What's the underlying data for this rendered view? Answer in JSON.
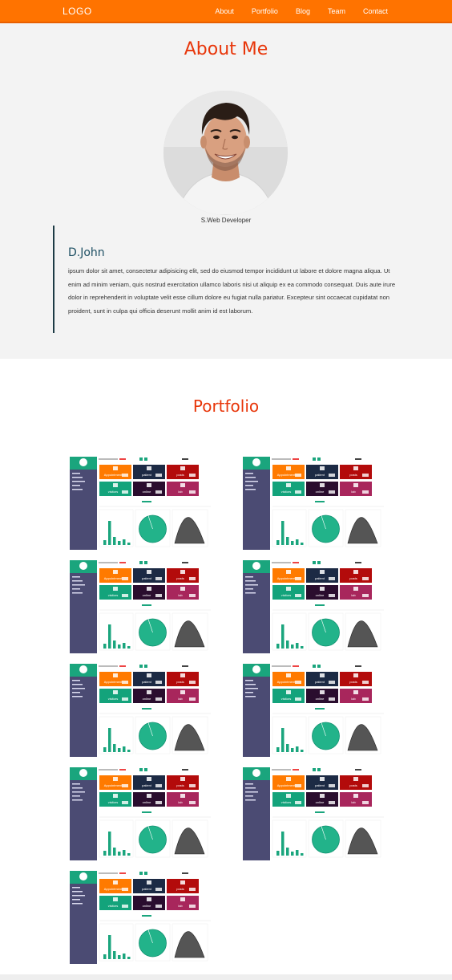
{
  "nav": {
    "logo": "LOGO",
    "links": [
      "About",
      "Portfolio",
      "Blog",
      "Team",
      "Contact"
    ]
  },
  "about": {
    "title": "About Me",
    "role": "S.Web Developer",
    "name": "D.John",
    "bio": "ipsum dolor sit amet, consectetur adipisicing elit, sed do eiusmod tempor incididunt ut labore et dolore magna aliqua. Ut enim ad minim veniam, quis nostrud exercitation ullamco laboris nisi ut aliquip ex ea commodo consequat. Duis aute irure dolor in reprehenderit in voluptate velit esse cillum dolore eu fugiat nulla pariatur. Excepteur sint occaecat cupidatat non proident, sunt in culpa qui officia deserunt mollit anim id est laborum."
  },
  "portfolio": {
    "title": "Portfolio",
    "items": [
      {
        "tiles": [
          "Appointment",
          "patient",
          "posts",
          "visitors",
          "online",
          "lab"
        ]
      },
      {
        "tiles": [
          "Appointment",
          "patient",
          "posts",
          "visitors",
          "online",
          "lab"
        ]
      },
      {
        "tiles": [
          "Appointment",
          "patient",
          "posts",
          "visitors",
          "online",
          "lab"
        ]
      },
      {
        "tiles": [
          "Appointment",
          "patient",
          "posts",
          "visitors",
          "online",
          "lab"
        ]
      },
      {
        "tiles": [
          "Appointment",
          "patient",
          "posts",
          "visitors",
          "online",
          "lab"
        ]
      },
      {
        "tiles": [
          "Appointment",
          "patient",
          "posts",
          "visitors",
          "online",
          "lab"
        ]
      },
      {
        "tiles": [
          "Appointment",
          "patient",
          "posts",
          "visitors",
          "online",
          "lab"
        ]
      },
      {
        "tiles": [
          "Appointment",
          "patient",
          "posts",
          "visitors",
          "online",
          "lab"
        ]
      },
      {
        "tiles": [
          "Appointment",
          "patient",
          "posts",
          "visitors",
          "online",
          "lab"
        ]
      }
    ]
  },
  "colors": {
    "nav": "#ff7300",
    "accent": "#e8360a",
    "teal": "#1aa57d",
    "sidebar": "#4b4b73"
  }
}
